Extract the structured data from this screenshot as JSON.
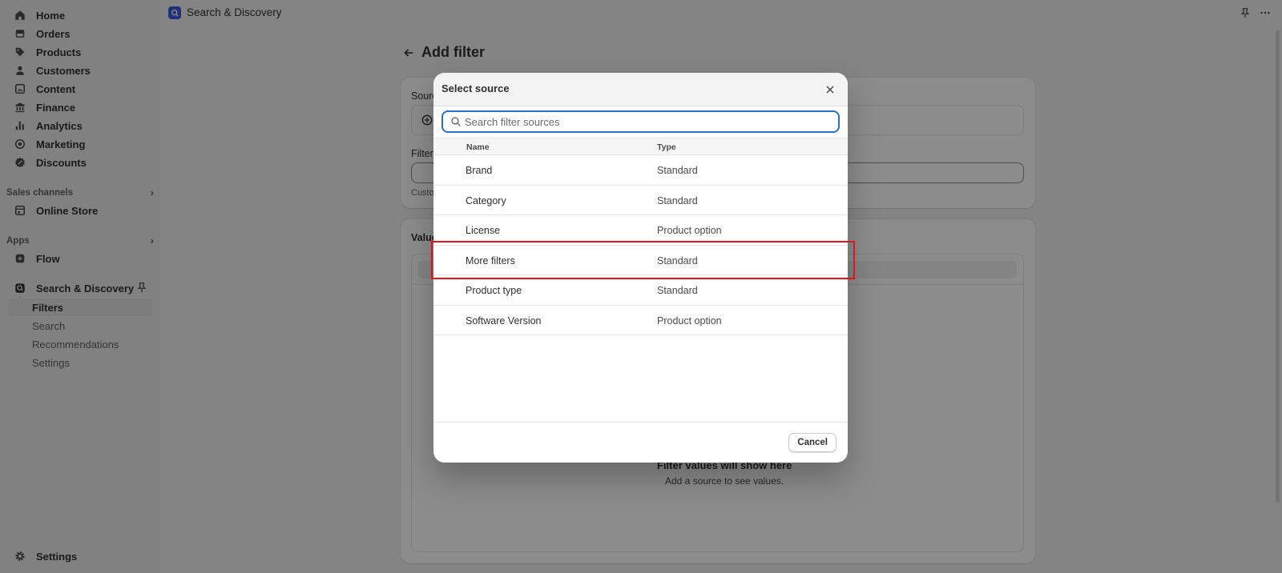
{
  "topbar": {
    "app_title": "Search & Discovery"
  },
  "sidebar": {
    "items": [
      {
        "label": "Home",
        "icon": "home-icon"
      },
      {
        "label": "Orders",
        "icon": "orders-icon"
      },
      {
        "label": "Products",
        "icon": "tag-icon"
      },
      {
        "label": "Customers",
        "icon": "person-icon"
      },
      {
        "label": "Content",
        "icon": "content-icon"
      },
      {
        "label": "Finance",
        "icon": "bank-icon"
      },
      {
        "label": "Analytics",
        "icon": "chart-icon"
      },
      {
        "label": "Marketing",
        "icon": "target-icon"
      },
      {
        "label": "Discounts",
        "icon": "discount-icon"
      }
    ],
    "sales_channels_title": "Sales channels",
    "online_store": "Online Store",
    "apps_title": "Apps",
    "flow": "Flow",
    "app_name": "Search & Discovery",
    "app_sub_items": [
      "Filters",
      "Search",
      "Recommendations",
      "Settings"
    ],
    "settings": "Settings"
  },
  "main": {
    "page_title": "Add filter",
    "source_label": "Sourc",
    "filter_label": "Filter",
    "custom_hint": "Custo",
    "values_label": "Value",
    "empty_title": "Filter values will show here",
    "empty_sub": "Add a source to see values."
  },
  "modal": {
    "title": "Select source",
    "search_placeholder": "Search filter sources",
    "col_name": "Name",
    "col_type": "Type",
    "rows": [
      {
        "name": "Brand",
        "type": "Standard"
      },
      {
        "name": "Category",
        "type": "Standard"
      },
      {
        "name": "License",
        "type": "Product option"
      },
      {
        "name": "More filters",
        "type": "Standard"
      },
      {
        "name": "Product type",
        "type": "Standard"
      },
      {
        "name": "Software Version",
        "type": "Product option"
      }
    ],
    "cancel_label": "Cancel"
  },
  "colors": {
    "highlight": "#e0141e",
    "focus_ring": "#2c6ecb"
  }
}
